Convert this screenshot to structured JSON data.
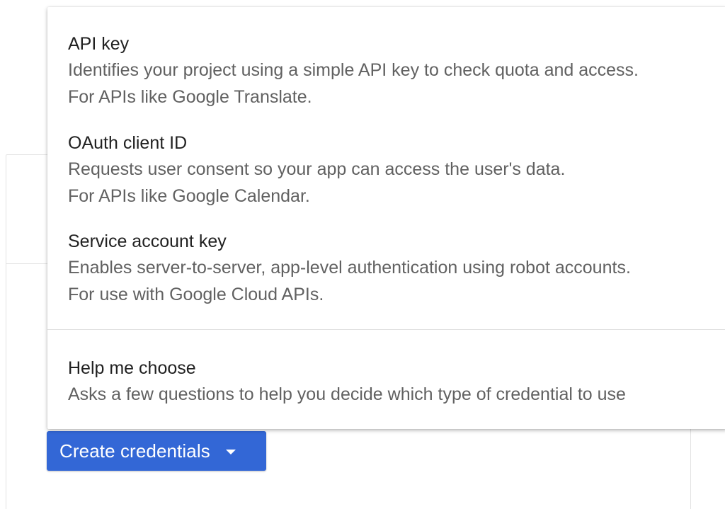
{
  "menu": {
    "items": [
      {
        "title": "API key",
        "desc_line1": "Identifies your project using a simple API key to check quota and access.",
        "desc_line2": "For APIs like Google Translate."
      },
      {
        "title": "OAuth client ID",
        "desc_line1": "Requests user consent so your app can access the user's data.",
        "desc_line2": "For APIs like Google Calendar."
      },
      {
        "title": "Service account key",
        "desc_line1": "Enables server-to-server, app-level authentication using robot accounts.",
        "desc_line2": "For use with Google Cloud APIs."
      }
    ],
    "help": {
      "title": "Help me choose",
      "desc": "Asks a few questions to help you decide which type of credential to use"
    }
  },
  "button": {
    "label": "Create credentials",
    "icon": "caret-down-icon"
  },
  "colors": {
    "primary": "#3367d6",
    "title_text": "#212121",
    "secondary_text": "#616161"
  }
}
